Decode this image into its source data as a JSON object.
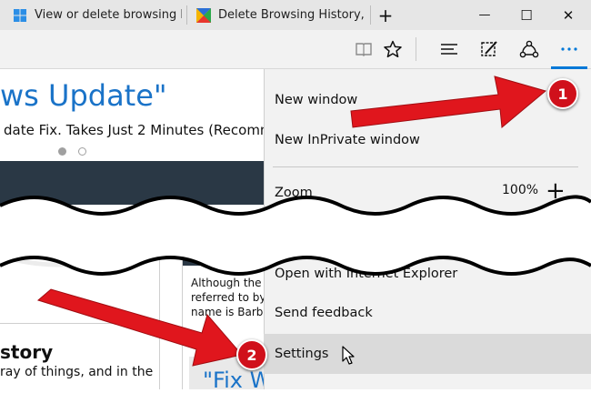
{
  "tabs": [
    {
      "label": "View or delete browsing his"
    },
    {
      "label": "Delete Browsing History, Co"
    }
  ],
  "window_controls": {
    "new_tab": "+",
    "minimize": "—",
    "maximize": "☐",
    "close": "✕"
  },
  "page": {
    "headline": "ws Update\"",
    "subline": "date Fix. Takes Just 2 Minutes (Recomm",
    "story_title": "story",
    "story_sub": "ray of things, and in the",
    "article_lines": [
      "Although the",
      "referred to by",
      "name is Barb"
    ],
    "fix_headline": "\"Fix Windows"
  },
  "menu": {
    "new_window": "New window",
    "new_inprivate": "New InPrivate window",
    "zoom_label": "Zoom",
    "zoom_value": "100%",
    "zoom_plus": "+",
    "open_ie": "Open with Internet Explorer",
    "send_feedback": "Send feedback",
    "settings": "Settings"
  },
  "annotations": {
    "step1": "1",
    "step2": "2"
  },
  "colors": {
    "accent": "#0078d7",
    "arrow_red": "#e0161d",
    "headline_blue": "#1a73c8"
  }
}
